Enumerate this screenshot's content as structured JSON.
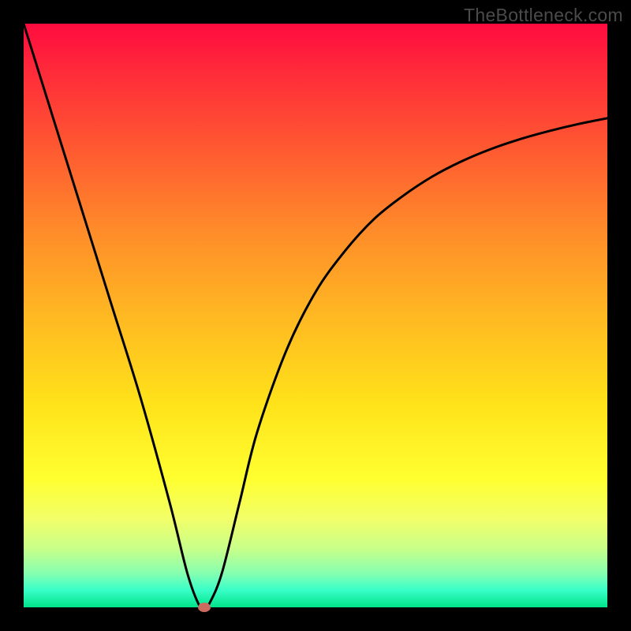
{
  "watermark": "TheBottleneck.com",
  "chart_data": {
    "type": "line",
    "title": "",
    "xlabel": "",
    "ylabel": "",
    "xlim": [
      0,
      100
    ],
    "ylim": [
      0,
      100
    ],
    "grid": false,
    "legend": false,
    "series": [
      {
        "name": "bottleneck-curve",
        "x": [
          0,
          5,
          10,
          15,
          20,
          25,
          28,
          30,
          31,
          32,
          34,
          37,
          40,
          45,
          50,
          55,
          60,
          65,
          70,
          75,
          80,
          85,
          90,
          95,
          100
        ],
        "y": [
          100,
          84,
          68,
          52,
          36,
          18,
          6,
          0.5,
          0,
          1,
          6,
          18,
          30,
          44,
          54,
          61,
          66.5,
          70.5,
          73.8,
          76.4,
          78.5,
          80.2,
          81.6,
          82.8,
          83.8
        ]
      }
    ],
    "marker": {
      "x": 31,
      "y": 0,
      "color": "#cc6a60"
    },
    "gradient_stops": [
      {
        "pos": 0,
        "color": "#ff0b3f"
      },
      {
        "pos": 8,
        "color": "#ff2a3a"
      },
      {
        "pos": 20,
        "color": "#ff5432"
      },
      {
        "pos": 35,
        "color": "#ff8a2a"
      },
      {
        "pos": 50,
        "color": "#ffb822"
      },
      {
        "pos": 65,
        "color": "#ffe21a"
      },
      {
        "pos": 78,
        "color": "#ffff30"
      },
      {
        "pos": 85,
        "color": "#f1ff6a"
      },
      {
        "pos": 90,
        "color": "#c7ff8a"
      },
      {
        "pos": 94,
        "color": "#8affb0"
      },
      {
        "pos": 97,
        "color": "#3affc8"
      },
      {
        "pos": 100,
        "color": "#00e38a"
      }
    ]
  }
}
